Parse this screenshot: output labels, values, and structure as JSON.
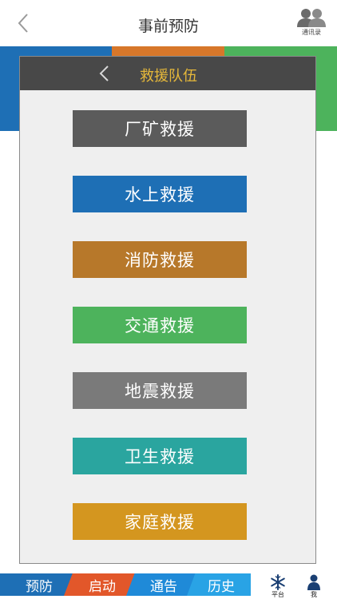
{
  "header": {
    "title": "事前预防",
    "contacts_label": "通讯录"
  },
  "modal": {
    "title": "救援队伍",
    "buttons": [
      {
        "label": "厂矿救援",
        "color": "#5b5b5b"
      },
      {
        "label": "水上救援",
        "color": "#1e6fb5"
      },
      {
        "label": "消防救援",
        "color": "#b7782a"
      },
      {
        "label": "交通救援",
        "color": "#4db35c"
      },
      {
        "label": "地震救援",
        "color": "#7a7a7a"
      },
      {
        "label": "卫生救援",
        "color": "#2aa59f"
      },
      {
        "label": "家庭救援",
        "color": "#d4961f"
      }
    ]
  },
  "tabs": [
    {
      "label": "预防",
      "color": "#1e6fb5"
    },
    {
      "label": "启动",
      "color": "#e2572a"
    },
    {
      "label": "通告",
      "color": "#1f8ad8"
    },
    {
      "label": "历史",
      "color": "#29a3e5"
    }
  ],
  "icon_tabs": {
    "platform_label": "平台",
    "me_label": "我"
  },
  "icons": {
    "back": "chevron-left-icon",
    "contacts": "contacts-icon",
    "platform": "snowflake-icon",
    "me": "user-icon"
  }
}
